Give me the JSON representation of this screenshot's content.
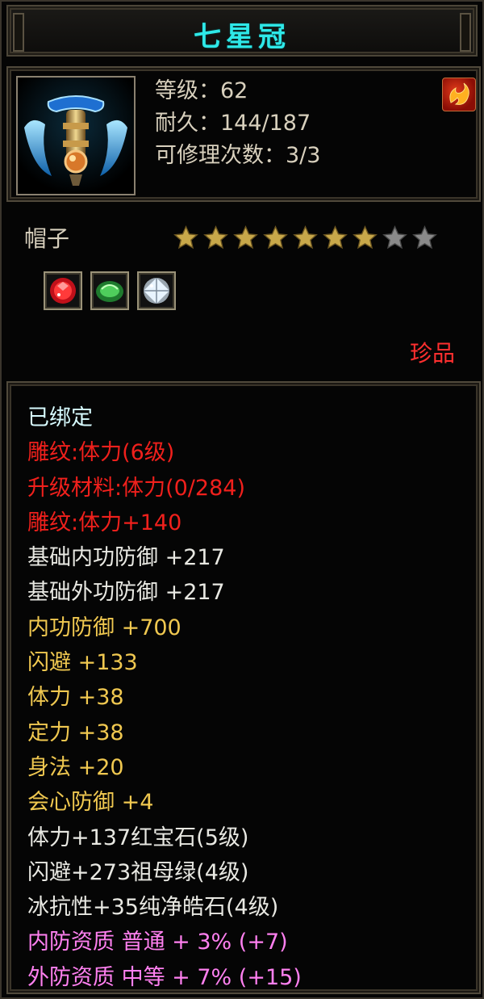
{
  "item": {
    "name": "七星冠",
    "level_line": "等级：62",
    "durability_line": "耐久：144/187",
    "repair_line": "可修理次数：3/3",
    "category": "帽子",
    "quality": "珍品",
    "stars": {
      "filled": 7,
      "total": 9
    },
    "gems": [
      "ruby-gem-icon",
      "emerald-gem-icon",
      "diamond-gem-icon"
    ]
  },
  "attributes": [
    {
      "text": "已绑定",
      "color": "cyan"
    },
    {
      "text": "雕纹:体力(6级)",
      "color": "red"
    },
    {
      "text": "升级材料:体力(0/284)",
      "color": "red"
    },
    {
      "text": "雕纹:体力+140",
      "color": "red"
    },
    {
      "text": "基础内功防御 +217",
      "color": "white"
    },
    {
      "text": "基础外功防御 +217",
      "color": "white"
    },
    {
      "text": "内功防御 +700",
      "color": "yellow"
    },
    {
      "text": "闪避 +133",
      "color": "yellow"
    },
    {
      "text": "体力 +38",
      "color": "yellow"
    },
    {
      "text": "定力 +38",
      "color": "yellow"
    },
    {
      "text": "身法 +20",
      "color": "yellow"
    },
    {
      "text": "会心防御 +4",
      "color": "yellow"
    },
    {
      "text": "体力+137红宝石(5级)",
      "color": "white"
    },
    {
      "text": "闪避+273祖母绿(4级)",
      "color": "white"
    },
    {
      "text": "冰抗性+35纯净皓石(4级)",
      "color": "white"
    },
    {
      "text": "内防资质 普通 + 3% (+7)",
      "color": "pink"
    },
    {
      "text": "外防资质 中等 + 7% (+15)",
      "color": "pink"
    }
  ],
  "colors": {
    "title": "#2ee8e8",
    "quality": "#ff2f2f",
    "star_filled": "#c8a84a",
    "star_empty": "#8a8a8a"
  }
}
